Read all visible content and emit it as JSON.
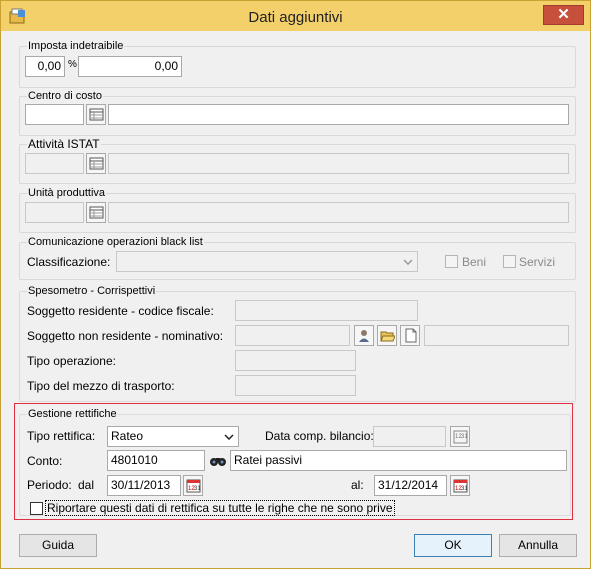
{
  "window": {
    "title": "Dati aggiuntivi",
    "close_glyph": "✕"
  },
  "imposta": {
    "group_label": "Imposta indetraibile",
    "percent_value": "0,00",
    "percent_sign": "%",
    "amount_value": "0,00"
  },
  "centro_costo": {
    "group_label": "Centro di costo",
    "code": "",
    "description": ""
  },
  "attivita": {
    "group_label": "Attività ISTAT",
    "code": "",
    "description": ""
  },
  "unita": {
    "group_label": "Unità produttiva",
    "code": "",
    "description": ""
  },
  "blacklist": {
    "group_label": "Comunicazione operazioni black list",
    "classificazione_label": "Classificazione:",
    "classificazione_value": "",
    "beni_label": "Beni",
    "servizi_label": "Servizi"
  },
  "spesometro": {
    "group_label": "Spesometro - Corrispettivi",
    "residente_label": "Soggetto residente - codice fiscale:",
    "residente_value": "",
    "non_residente_label": "Soggetto non residente - nominativo:",
    "non_residente_value": "",
    "non_residente_extra": "",
    "tipo_operazione_label": "Tipo operazione:",
    "tipo_operazione_value": "",
    "tipo_mezzo_label": "Tipo del mezzo di trasporto:",
    "tipo_mezzo_value": ""
  },
  "rettifiche": {
    "group_label": "Gestione rettifiche",
    "tipo_label": "Tipo rettifica:",
    "tipo_value": "Rateo",
    "data_comp_label": "Data comp. bilancio:",
    "data_comp_value": "",
    "conto_label": "Conto:",
    "conto_code": "4801010",
    "conto_description": "Ratei passivi",
    "periodo_label": "Periodo:",
    "dal_label": "dal",
    "dal_value": "30/11/2013",
    "al_label": "al:",
    "al_value": "31/12/2014",
    "riportare_label": "Riportare questi dati di rettifica su tutte le righe che ne sono prive"
  },
  "footer": {
    "guida_label": "Guida",
    "ok_label": "OK",
    "annulla_label": "Annulla"
  },
  "colors": {
    "titlebar": "#f4d06a",
    "close": "#c7503d",
    "highlight_border": "#e0303f"
  }
}
